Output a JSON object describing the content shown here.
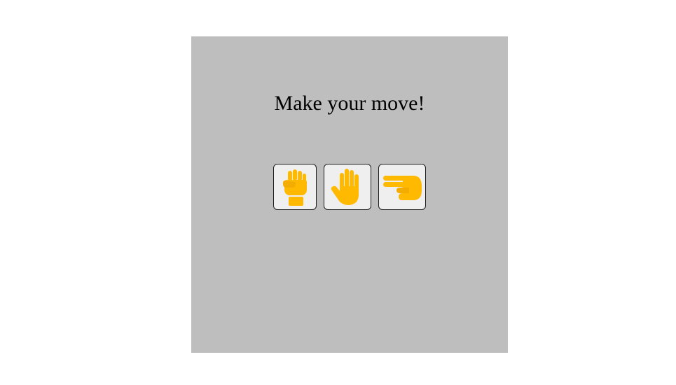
{
  "game": {
    "prompt": "Make your move!",
    "moves": [
      {
        "id": "rock",
        "icon": "raised-fist-icon"
      },
      {
        "id": "paper",
        "icon": "raised-hand-icon"
      },
      {
        "id": "scissors",
        "icon": "pointing-fingers-icon"
      }
    ]
  },
  "colors": {
    "panel": "#bebebe",
    "button": "#efefef",
    "hand": "#ffb900"
  }
}
